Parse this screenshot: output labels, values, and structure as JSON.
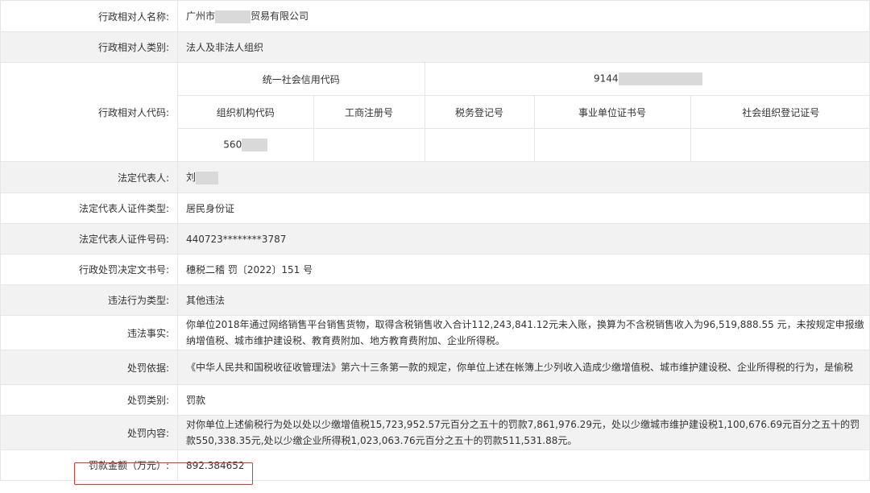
{
  "rows": {
    "name": {
      "label": "行政相对人名称:",
      "prefix": "广州市",
      "suffix": "贸易有限公司"
    },
    "category": {
      "label": "行政相对人类别:",
      "value": "法人及非法人组织"
    },
    "code": {
      "label": "行政相对人代码:",
      "usc_label": "统一社会信用代码",
      "usc_value_prefix": "9144",
      "headers": [
        "组织机构代码",
        "工商注册号",
        "税务登记号",
        "事业单位证书号",
        "社会组织登记证号"
      ],
      "org_code_prefix": "560"
    },
    "legal_rep": {
      "label": "法定代表人:",
      "prefix": "刘"
    },
    "id_type": {
      "label": "法定代表人证件类型:",
      "value": "居民身份证"
    },
    "id_no": {
      "label": "法定代表人证件号码:",
      "value": "440723********3787"
    },
    "doc_no": {
      "label": "行政处罚决定文书号:",
      "value": "穗税二稽 罚〔2022〕151 号"
    },
    "violation_type": {
      "label": "违法行为类型:",
      "value": "其他违法"
    },
    "facts": {
      "label": "违法事实:",
      "value": "你单位2018年通过网络销售平台销售货物，取得含税销售收入合计112,243,841.12元未入账，换算为不含税销售收入为96,519,888.55 元，未按规定申报缴纳增值税、城市维护建设税、教育费附加、地方教育费附加、企业所得税。"
    },
    "basis": {
      "label": "处罚依据:",
      "value": "《中华人民共和国税收征收管理法》第六十三条第一款的规定，你单位上述在帐簿上少列收入造成少缴增值税、城市维护建设税、企业所得税的行为，是偷税"
    },
    "penalty_type": {
      "label": "处罚类别:",
      "value": "罚款"
    },
    "penalty_content": {
      "label": "处罚内容:",
      "value": "对你单位上述偷税行为处以处以少缴增值税15,723,952.57元百分之五十的罚款7,861,976.29元，处以少缴城市维护建设税1,100,676.69元百分之五十的罚款550,338.35元,处以少缴企业所得税1,023,063.76元百分之五十的罚款511,531.88元。"
    },
    "amount": {
      "label": "罚款金额（万元）:",
      "value": "892.384652"
    }
  },
  "colors": {
    "highlight": "#e0322f",
    "row_alt": "#f2f2f2",
    "border": "#e6e6e6"
  }
}
